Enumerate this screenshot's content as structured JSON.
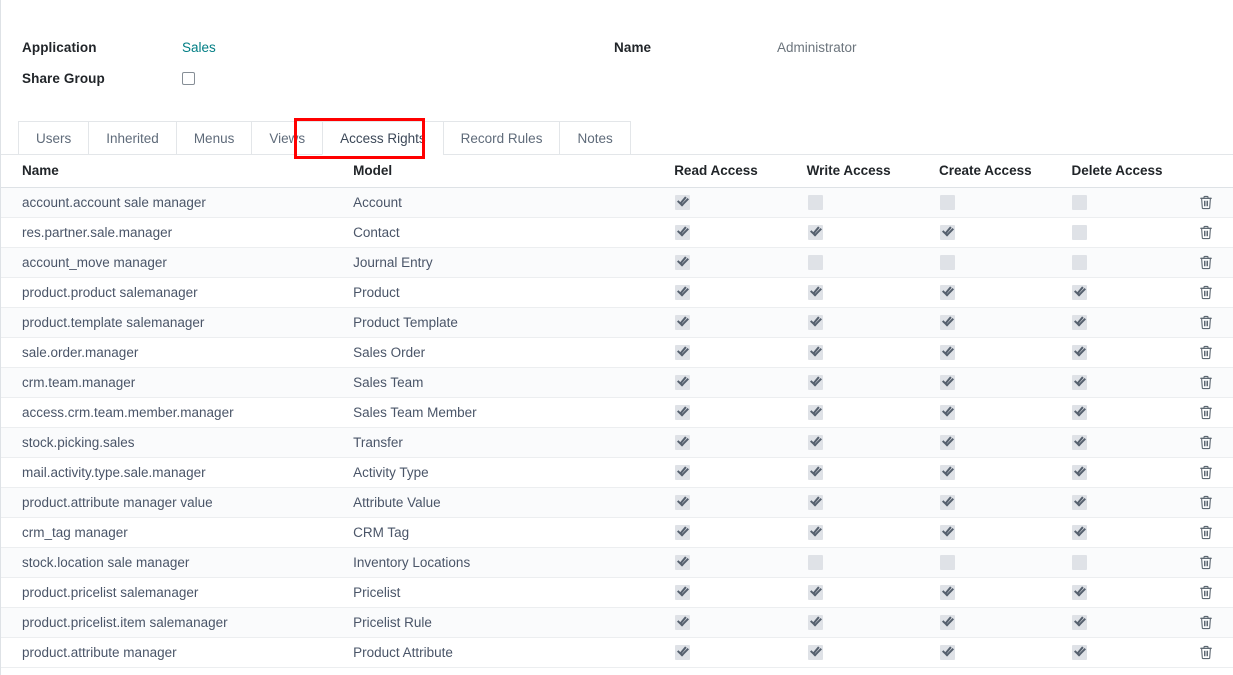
{
  "form": {
    "application_label": "Application",
    "application_value": "Sales",
    "share_group_label": "Share Group",
    "share_group_checked": false,
    "name_label": "Name",
    "name_value": "Administrator",
    "link_color": "#017e84"
  },
  "tabs": {
    "items": [
      {
        "label": "Users",
        "active": false
      },
      {
        "label": "Inherited",
        "active": false
      },
      {
        "label": "Menus",
        "active": false
      },
      {
        "label": "Views",
        "active": false
      },
      {
        "label": "Access Rights",
        "active": true
      },
      {
        "label": "Record Rules",
        "active": false
      },
      {
        "label": "Notes",
        "active": false
      }
    ],
    "highlight_color": "#ff0000",
    "highlighted_tab": "Access Rights"
  },
  "table": {
    "headers": {
      "name": "Name",
      "model": "Model",
      "read": "Read Access",
      "write": "Write Access",
      "create": "Create Access",
      "delete": "Delete Access"
    },
    "delete_icon": "trash-icon",
    "rows": [
      {
        "name": "account.account sale manager",
        "model": "Account",
        "read": true,
        "write": false,
        "create": false,
        "delete": false
      },
      {
        "name": "res.partner.sale.manager",
        "model": "Contact",
        "read": true,
        "write": true,
        "create": true,
        "delete": false
      },
      {
        "name": "account_move manager",
        "model": "Journal Entry",
        "read": true,
        "write": false,
        "create": false,
        "delete": false
      },
      {
        "name": "product.product salemanager",
        "model": "Product",
        "read": true,
        "write": true,
        "create": true,
        "delete": true
      },
      {
        "name": "product.template salemanager",
        "model": "Product Template",
        "read": true,
        "write": true,
        "create": true,
        "delete": true
      },
      {
        "name": "sale.order.manager",
        "model": "Sales Order",
        "read": true,
        "write": true,
        "create": true,
        "delete": true
      },
      {
        "name": "crm.team.manager",
        "model": "Sales Team",
        "read": true,
        "write": true,
        "create": true,
        "delete": true
      },
      {
        "name": "access.crm.team.member.manager",
        "model": "Sales Team Member",
        "read": true,
        "write": true,
        "create": true,
        "delete": true
      },
      {
        "name": "stock.picking.sales",
        "model": "Transfer",
        "read": true,
        "write": true,
        "create": true,
        "delete": true
      },
      {
        "name": "mail.activity.type.sale.manager",
        "model": "Activity Type",
        "read": true,
        "write": true,
        "create": true,
        "delete": true
      },
      {
        "name": "product.attribute manager value",
        "model": "Attribute Value",
        "read": true,
        "write": true,
        "create": true,
        "delete": true
      },
      {
        "name": "crm_tag manager",
        "model": "CRM Tag",
        "read": true,
        "write": true,
        "create": true,
        "delete": true
      },
      {
        "name": "stock.location sale manager",
        "model": "Inventory Locations",
        "read": true,
        "write": false,
        "create": false,
        "delete": false
      },
      {
        "name": "product.pricelist salemanager",
        "model": "Pricelist",
        "read": true,
        "write": true,
        "create": true,
        "delete": true
      },
      {
        "name": "product.pricelist.item salemanager",
        "model": "Pricelist Rule",
        "read": true,
        "write": true,
        "create": true,
        "delete": true
      },
      {
        "name": "product.attribute manager",
        "model": "Product Attribute",
        "read": true,
        "write": true,
        "create": true,
        "delete": true
      }
    ]
  }
}
